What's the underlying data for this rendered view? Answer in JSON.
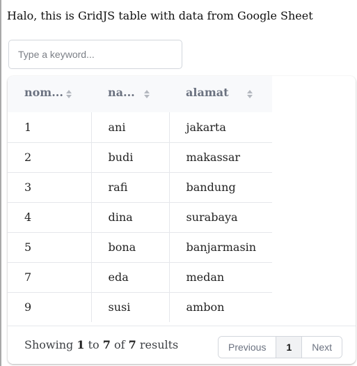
{
  "page": {
    "title": "Halo, this is GridJS table with data from Google Sheet"
  },
  "search": {
    "placeholder": "Type a keyword..."
  },
  "table": {
    "columns": [
      {
        "label": "nom...",
        "sort_icon": "sort-icon"
      },
      {
        "label": "na...",
        "sort_icon": "sort-icon"
      },
      {
        "label": "alamat",
        "sort_icon": "sort-icon"
      }
    ],
    "rows": [
      [
        "1",
        "ani",
        "jakarta"
      ],
      [
        "2",
        "budi",
        "makassar"
      ],
      [
        "3",
        "rafi",
        "bandung"
      ],
      [
        "4",
        "dina",
        "surabaya"
      ],
      [
        "5",
        "bona",
        "banjarmasin"
      ],
      [
        "7",
        "eda",
        "medan"
      ],
      [
        "9",
        "susi",
        "ambon"
      ]
    ]
  },
  "footer": {
    "showing": "Showing",
    "from": "1",
    "to_word": "to",
    "to": "7",
    "of_word": "of",
    "total": "7",
    "results": "results"
  },
  "pagination": {
    "previous": "Previous",
    "current": "1",
    "next": "Next"
  }
}
